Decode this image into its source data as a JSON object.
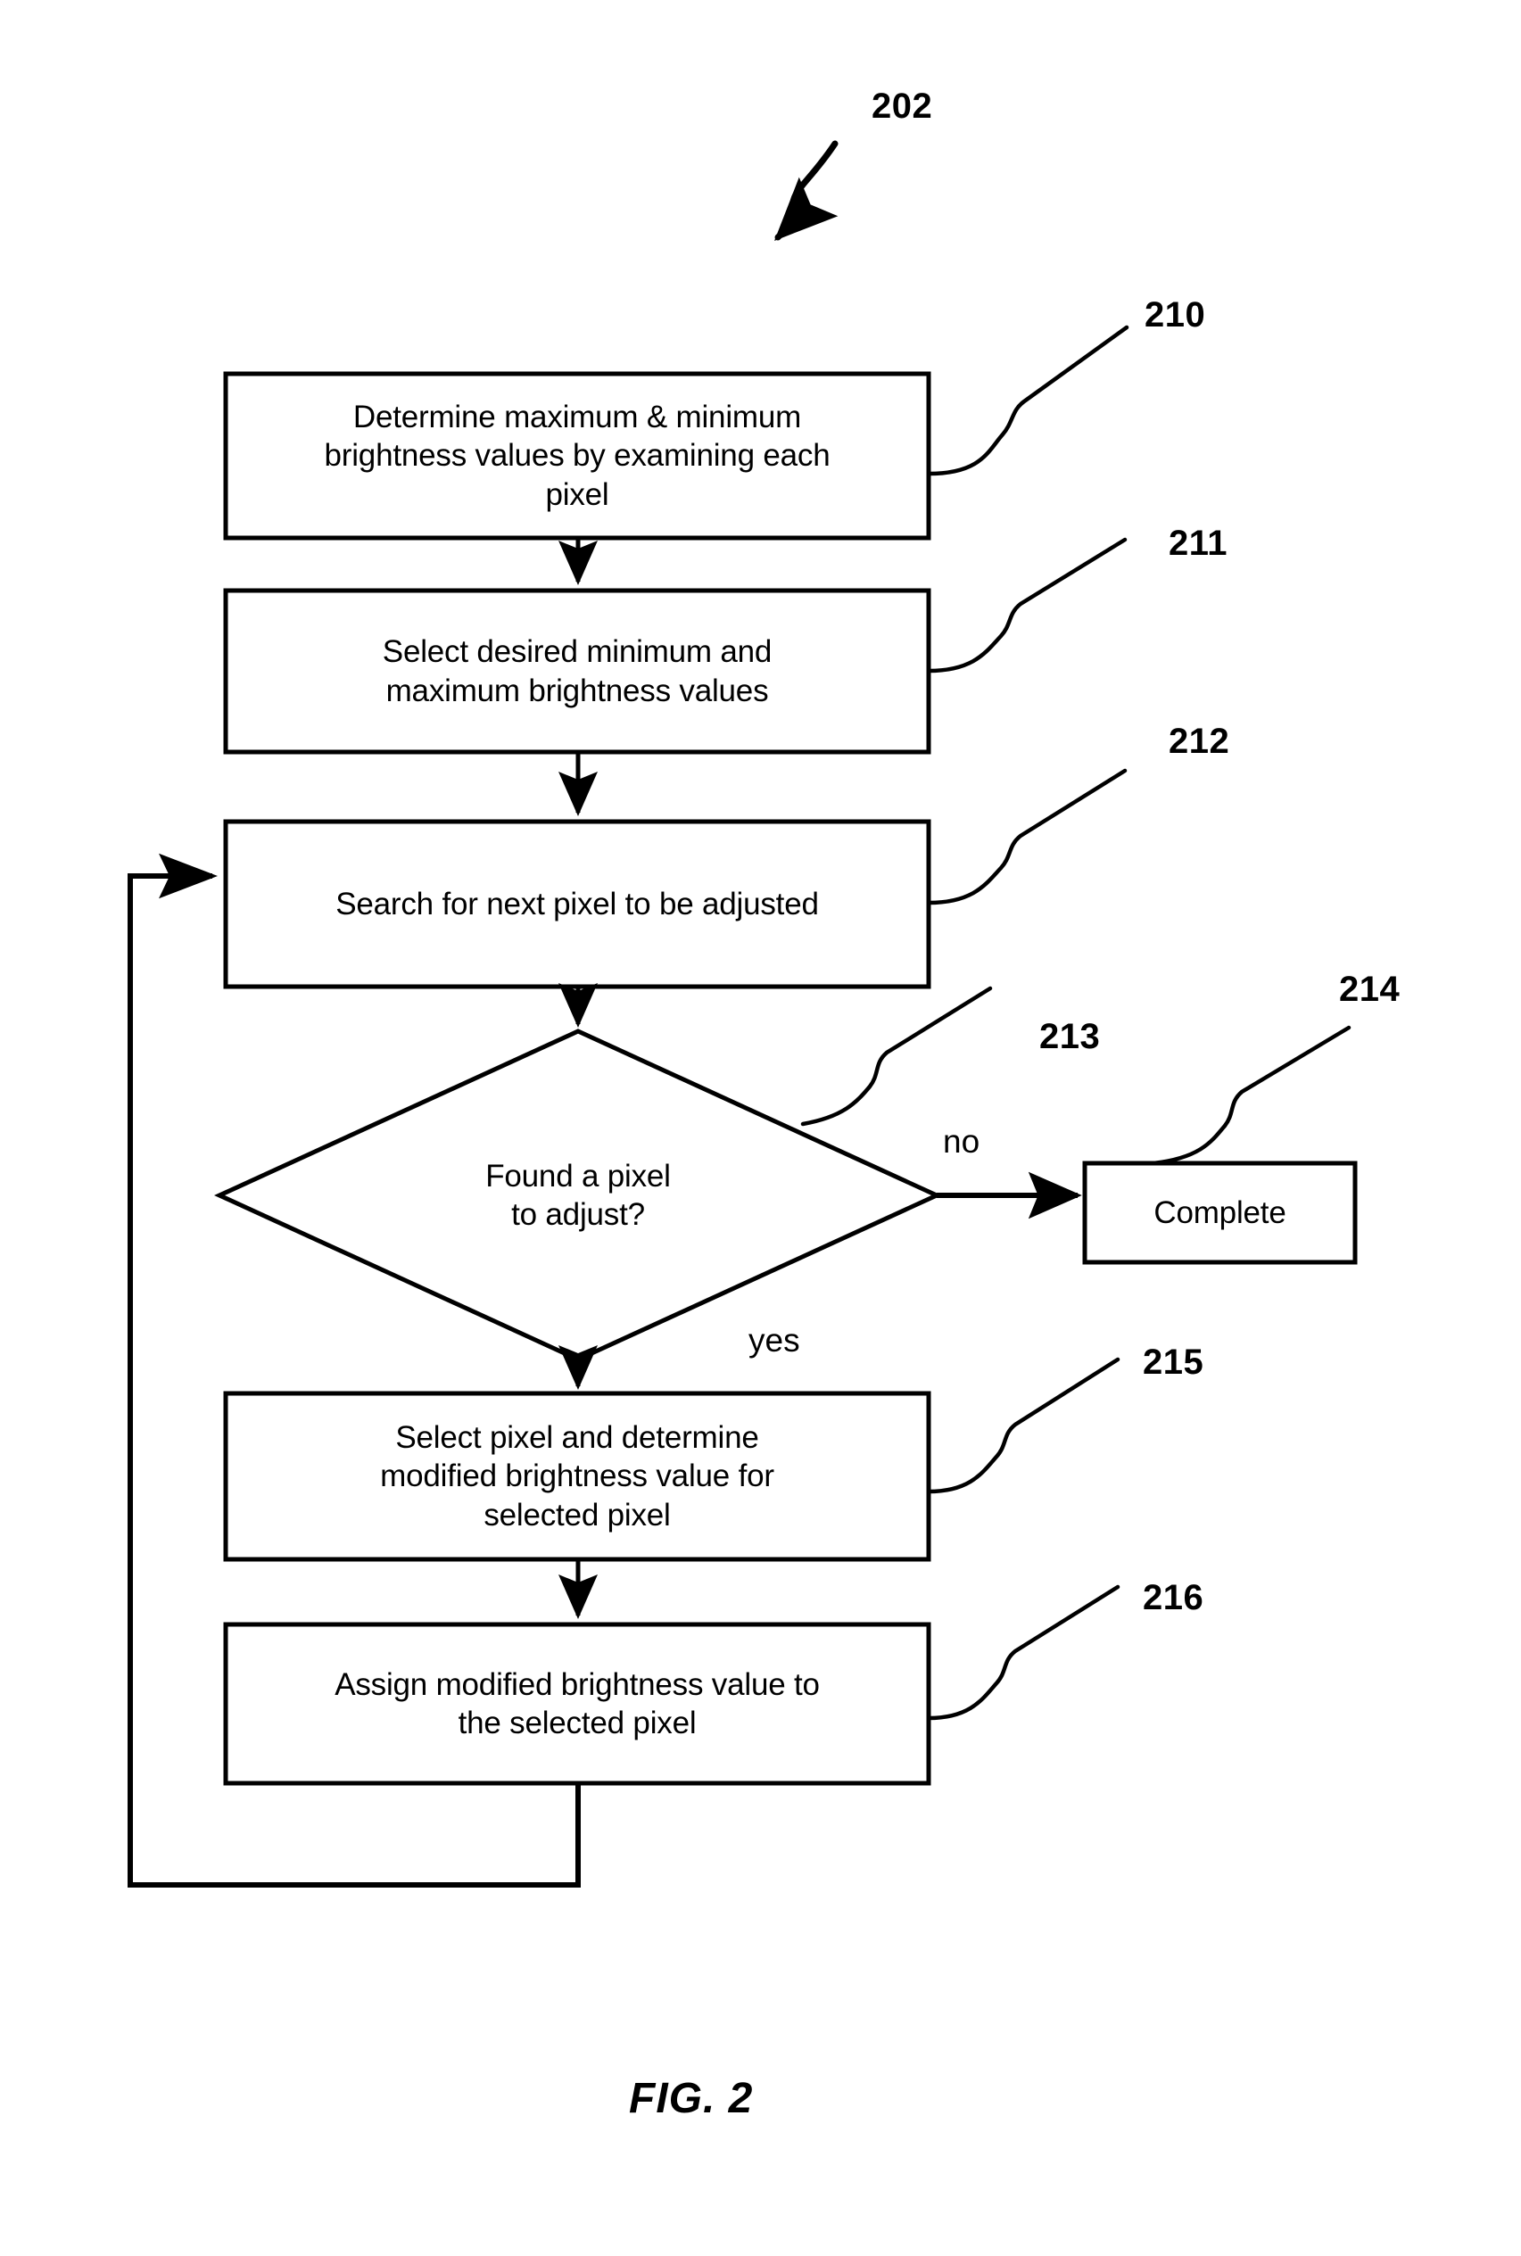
{
  "figure": {
    "caption": "FIG.  2",
    "diagram_ref": "202"
  },
  "nodes": [
    {
      "id": "210",
      "shape": "process",
      "text": "Determine maximum & minimum\nbrightness values by examining each\npixel",
      "ref": "210"
    },
    {
      "id": "211",
      "shape": "process",
      "text": "Select desired minimum and\nmaximum brightness values",
      "ref": "211"
    },
    {
      "id": "212",
      "shape": "process",
      "text": "Search for next pixel to be adjusted",
      "ref": "212"
    },
    {
      "id": "213",
      "shape": "decision",
      "text": "Found a pixel\nto adjust?",
      "ref": "213"
    },
    {
      "id": "214",
      "shape": "terminator",
      "text": "Complete",
      "ref": "214"
    },
    {
      "id": "215",
      "shape": "process",
      "text": "Select pixel and determine\nmodified brightness value for\nselected pixel",
      "ref": "215"
    },
    {
      "id": "216",
      "shape": "process",
      "text": "Assign modified brightness value to\nthe selected pixel",
      "ref": "216"
    }
  ],
  "edge_labels": {
    "no": "no",
    "yes": "yes"
  },
  "colors": {
    "stroke": "#000000",
    "fill": "#ffffff",
    "text": "#000000"
  }
}
